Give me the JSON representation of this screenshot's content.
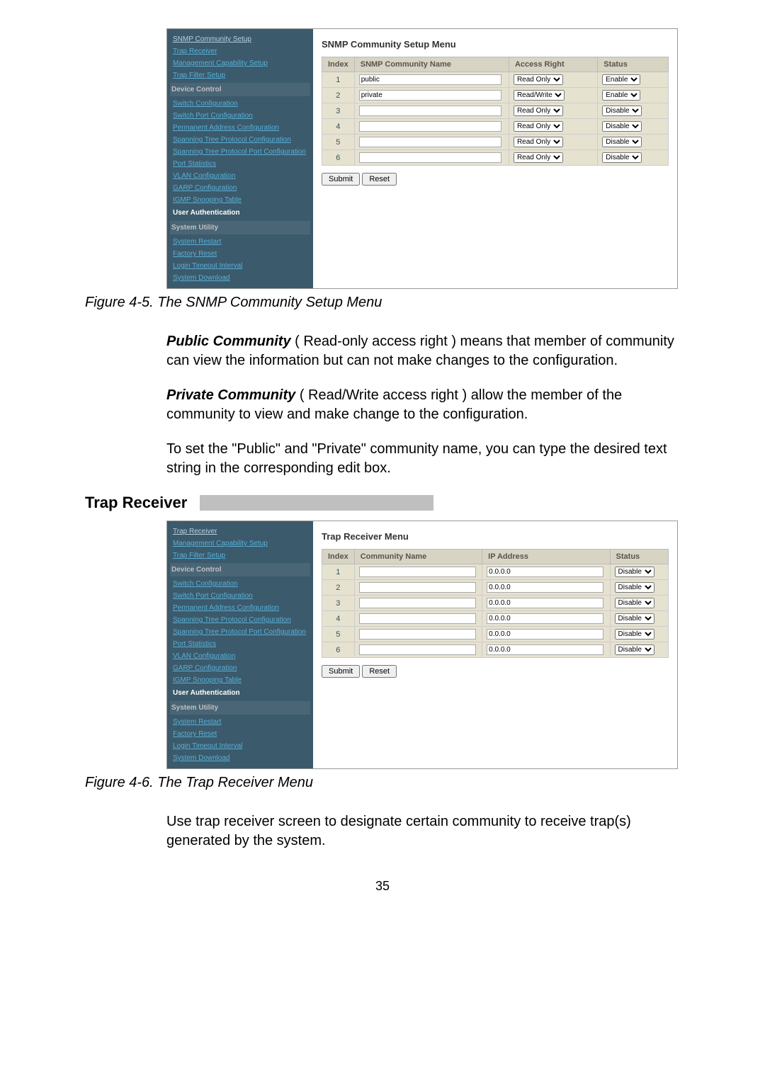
{
  "snmp_menu": {
    "title": "SNMP Community Setup Menu",
    "headers": [
      "Index",
      "SNMP Community Name",
      "Access Right",
      "Status"
    ],
    "rows": [
      {
        "index": "1",
        "name": "public",
        "access": "Read Only",
        "status": "Enable"
      },
      {
        "index": "2",
        "name": "private",
        "access": "Read/Write",
        "status": "Enable"
      },
      {
        "index": "3",
        "name": "",
        "access": "Read Only",
        "status": "Disable"
      },
      {
        "index": "4",
        "name": "",
        "access": "Read Only",
        "status": "Disable"
      },
      {
        "index": "5",
        "name": "",
        "access": "Read Only",
        "status": "Disable"
      },
      {
        "index": "6",
        "name": "",
        "access": "Read Only",
        "status": "Disable"
      }
    ],
    "buttons": {
      "submit": "Submit",
      "reset": "Reset"
    },
    "sidebar": {
      "snmp_community_setup": "SNMP Community Setup",
      "trap_receiver": "Trap Receiver",
      "management_capability_setup": "Management Capability Setup",
      "trap_filter_setup": "Trap Filter Setup",
      "device_control_hdr": "Device Control",
      "switch_configuration": "Switch Configuration",
      "switch_port_configuration": "Switch Port Configuration",
      "permanent_address": "Permanent Address Configuration",
      "spanning_tree_protocol_cfg": "Spanning Tree Protocol Configuration",
      "spanning_tree_protocol_port_cfg": "Spanning Tree Protocol Port Configuration",
      "port_statistics": "Port Statistics",
      "vlan_configuration": "VLAN Configuration",
      "garp_configuration": "GARP Configuration",
      "igmp_snooping_table": "IGMP Snooping Table",
      "user_auth_hdr": "User Authentication",
      "system_utility_hdr": "System Utility",
      "system_restart": "System Restart",
      "factory_reset": "Factory Reset",
      "login_timeout_interval": "Login Timeout Interval",
      "system_download": "System Download"
    }
  },
  "caption1": "Figure 4-5. The SNMP Community Setup Menu",
  "para1_lead": "Public Community",
  "para1_rest": " ( Read-only access right ) means that member of community can view the information but can not make changes to the configuration.",
  "para2_lead": "Private Community",
  "para2_rest": " ( Read/Write access right ) allow the member of the community to view and make change to the configuration.",
  "para3": "To set the \"Public\" and \"Private\" community name, you can type the desired text string in the corresponding edit box.",
  "section_trap_receiver": "Trap Receiver",
  "trap_menu": {
    "title": "Trap Receiver Menu",
    "headers": [
      "Index",
      "Community Name",
      "IP Address",
      "Status"
    ],
    "rows": [
      {
        "index": "1",
        "name": "",
        "ip": "0.0.0.0",
        "status": "Disable"
      },
      {
        "index": "2",
        "name": "",
        "ip": "0.0.0.0",
        "status": "Disable"
      },
      {
        "index": "3",
        "name": "",
        "ip": "0.0.0.0",
        "status": "Disable"
      },
      {
        "index": "4",
        "name": "",
        "ip": "0.0.0.0",
        "status": "Disable"
      },
      {
        "index": "5",
        "name": "",
        "ip": "0.0.0.0",
        "status": "Disable"
      },
      {
        "index": "6",
        "name": "",
        "ip": "0.0.0.0",
        "status": "Disable"
      }
    ],
    "buttons": {
      "submit": "Submit",
      "reset": "Reset"
    },
    "sidebar": {
      "trap_receiver": "Trap Receiver",
      "management_capability_setup": "Management Capability Setup",
      "trap_filter_setup": "Trap Filter Setup",
      "device_control_hdr": "Device Control",
      "switch_configuration": "Switch Configuration",
      "switch_port_configuration": "Switch Port Configuration",
      "permanent_address": "Permanent Address Configuration",
      "spanning_tree_protocol_cfg": "Spanning Tree Protocol Configuration",
      "spanning_tree_protocol_port_cfg": "Spanning Tree Protocol Port Configuration",
      "port_statistics": "Port Statistics",
      "vlan_configuration": "VLAN Configuration",
      "garp_configuration": "GARP Configuration",
      "igmp_snooping_table": "IGMP Snooping Table",
      "user_auth_hdr": "User Authentication",
      "system_utility_hdr": "System Utility",
      "system_restart": "System Restart",
      "factory_reset": "Factory Reset",
      "login_timeout_interval": "Login Timeout Interval",
      "system_download": "System Download"
    }
  },
  "caption2": "Figure 4-6. The Trap Receiver Menu",
  "para4": "Use trap receiver screen to designate certain community to receive trap(s) generated by the system.",
  "page_number": "35"
}
